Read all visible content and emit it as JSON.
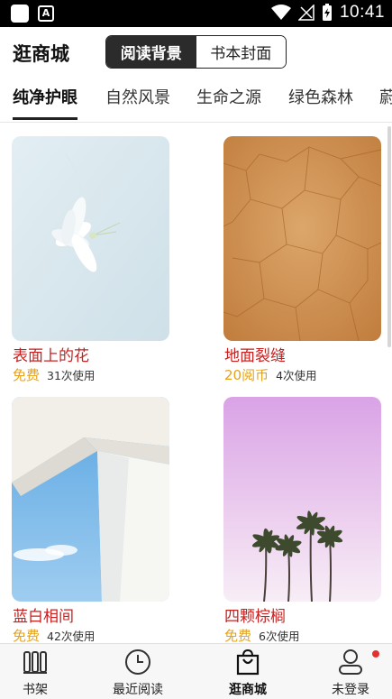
{
  "status_bar": {
    "time": "10:41"
  },
  "header": {
    "title": "逛商城",
    "segments": [
      {
        "label": "阅读背景",
        "active": true
      },
      {
        "label": "书本封面",
        "active": false
      }
    ]
  },
  "categories": [
    {
      "label": "纯净护眼",
      "active": true
    },
    {
      "label": "自然风景",
      "active": false
    },
    {
      "label": "生命之源",
      "active": false
    },
    {
      "label": "绿色森林",
      "active": false
    },
    {
      "label": "蔚",
      "active": false
    }
  ],
  "items": [
    {
      "name": "表面上的花",
      "price": "免费",
      "uses": "31次使用",
      "image": "white-lily-flower"
    },
    {
      "name": "地面裂缝",
      "price": "20阅币",
      "uses": "4次使用",
      "image": "cracked-ground"
    },
    {
      "name": "蓝白相间",
      "price": "免费",
      "uses": "42次使用",
      "image": "white-building-blue-sky"
    },
    {
      "name": "四颗棕榈",
      "price": "免费",
      "uses": "6次使用",
      "image": "four-palm-trees"
    }
  ],
  "bottom_nav": [
    {
      "label": "书架",
      "icon": "bookshelf-icon",
      "active": false
    },
    {
      "label": "最近阅读",
      "icon": "clock-icon",
      "active": false
    },
    {
      "label": "逛商城",
      "icon": "shopping-bag-icon",
      "active": true
    },
    {
      "label": "未登录",
      "icon": "user-icon",
      "active": false,
      "badge": true
    }
  ],
  "colors": {
    "item_name": "#c8201f",
    "price": "#e5a21a",
    "segment_active_bg": "#2b2b2b",
    "badge": "#e53030"
  }
}
